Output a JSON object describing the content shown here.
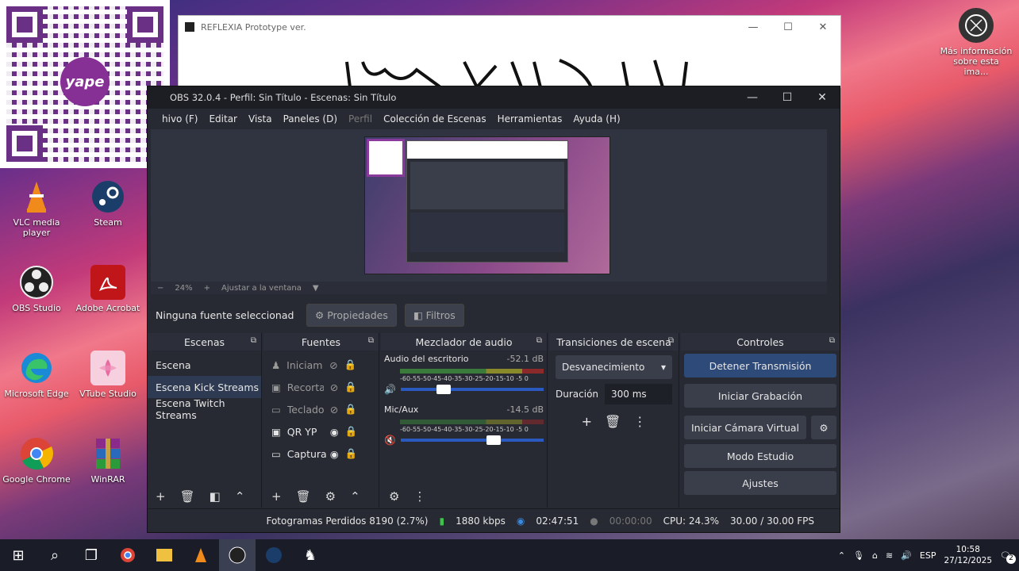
{
  "desktop": {
    "icons": [
      {
        "label": "VLC media player"
      },
      {
        "label": "Steam"
      },
      {
        "label": "OBS Studio"
      },
      {
        "label": "Adobe Acrobat"
      },
      {
        "label": "Microsoft Edge"
      },
      {
        "label": "VTube Studio"
      },
      {
        "label": "Google Chrome"
      },
      {
        "label": "WinRAR"
      }
    ],
    "info_icon_label": "Más información sobre esta ima..."
  },
  "qr": {
    "brand": "yape"
  },
  "reflexia": {
    "title": "REFLEXIA Prototype ver."
  },
  "obs": {
    "title": "OBS 32.0.4 - Perfil: Sin Título - Escenas: Sin Título",
    "menu": [
      "hivo (F)",
      "Editar",
      "Vista",
      "Paneles (D)",
      "Perfil",
      "Colección de Escenas",
      "Herramientas",
      "Ayuda (H)"
    ],
    "zoom": {
      "minus": "−",
      "value": "24%",
      "plus": "+",
      "fit": "Ajustar a la ventana"
    },
    "source_bar": {
      "no_source": "Ninguna fuente seleccionad",
      "properties": "Propiedades",
      "filters": "Filtros"
    },
    "scenes": {
      "header": "Escenas",
      "items": [
        "Escena",
        "Escena Kick Streams",
        "Escena Twitch Streams"
      ],
      "selected_index": 1
    },
    "sources": {
      "header": "Fuentes",
      "items": [
        "Iniciamo",
        "Recorta",
        "Teclado",
        "QR YP",
        "Captura"
      ]
    },
    "mixer": {
      "header": "Mezclador de audio",
      "channels": [
        {
          "name": "Audio del escritorio",
          "db": "-52.1 dB",
          "level_fraction": 0.25
        },
        {
          "name": "Mic/Aux",
          "db": "-14.5 dB",
          "level_fraction": 0.6
        }
      ],
      "scale": "-60-55-50-45-40-35-30-25-20-15-10 -5 0"
    },
    "transitions": {
      "header": "Transiciones de escena",
      "type": "Desvanecimiento",
      "duration_label": "Duración",
      "duration_value": "300 ms"
    },
    "controls": {
      "header": "Controles",
      "buttons": [
        "Detener Transmisión",
        "Iniciar Grabación",
        "Iniciar Cámara Virtual",
        "Modo Estudio",
        "Ajustes"
      ]
    },
    "status": {
      "dropped": "Fotogramas Perdidos 8190 (2.7%)",
      "bitrate": "1880 kbps",
      "stream_time": "02:47:51",
      "rec_time": "00:00:00",
      "cpu": "CPU: 24.3%",
      "fps": "30.00 / 30.00 FPS"
    }
  },
  "taskbar": {
    "lang": "ESP",
    "time": "10:58",
    "date": "27/12/2025",
    "notif_count": "2"
  }
}
